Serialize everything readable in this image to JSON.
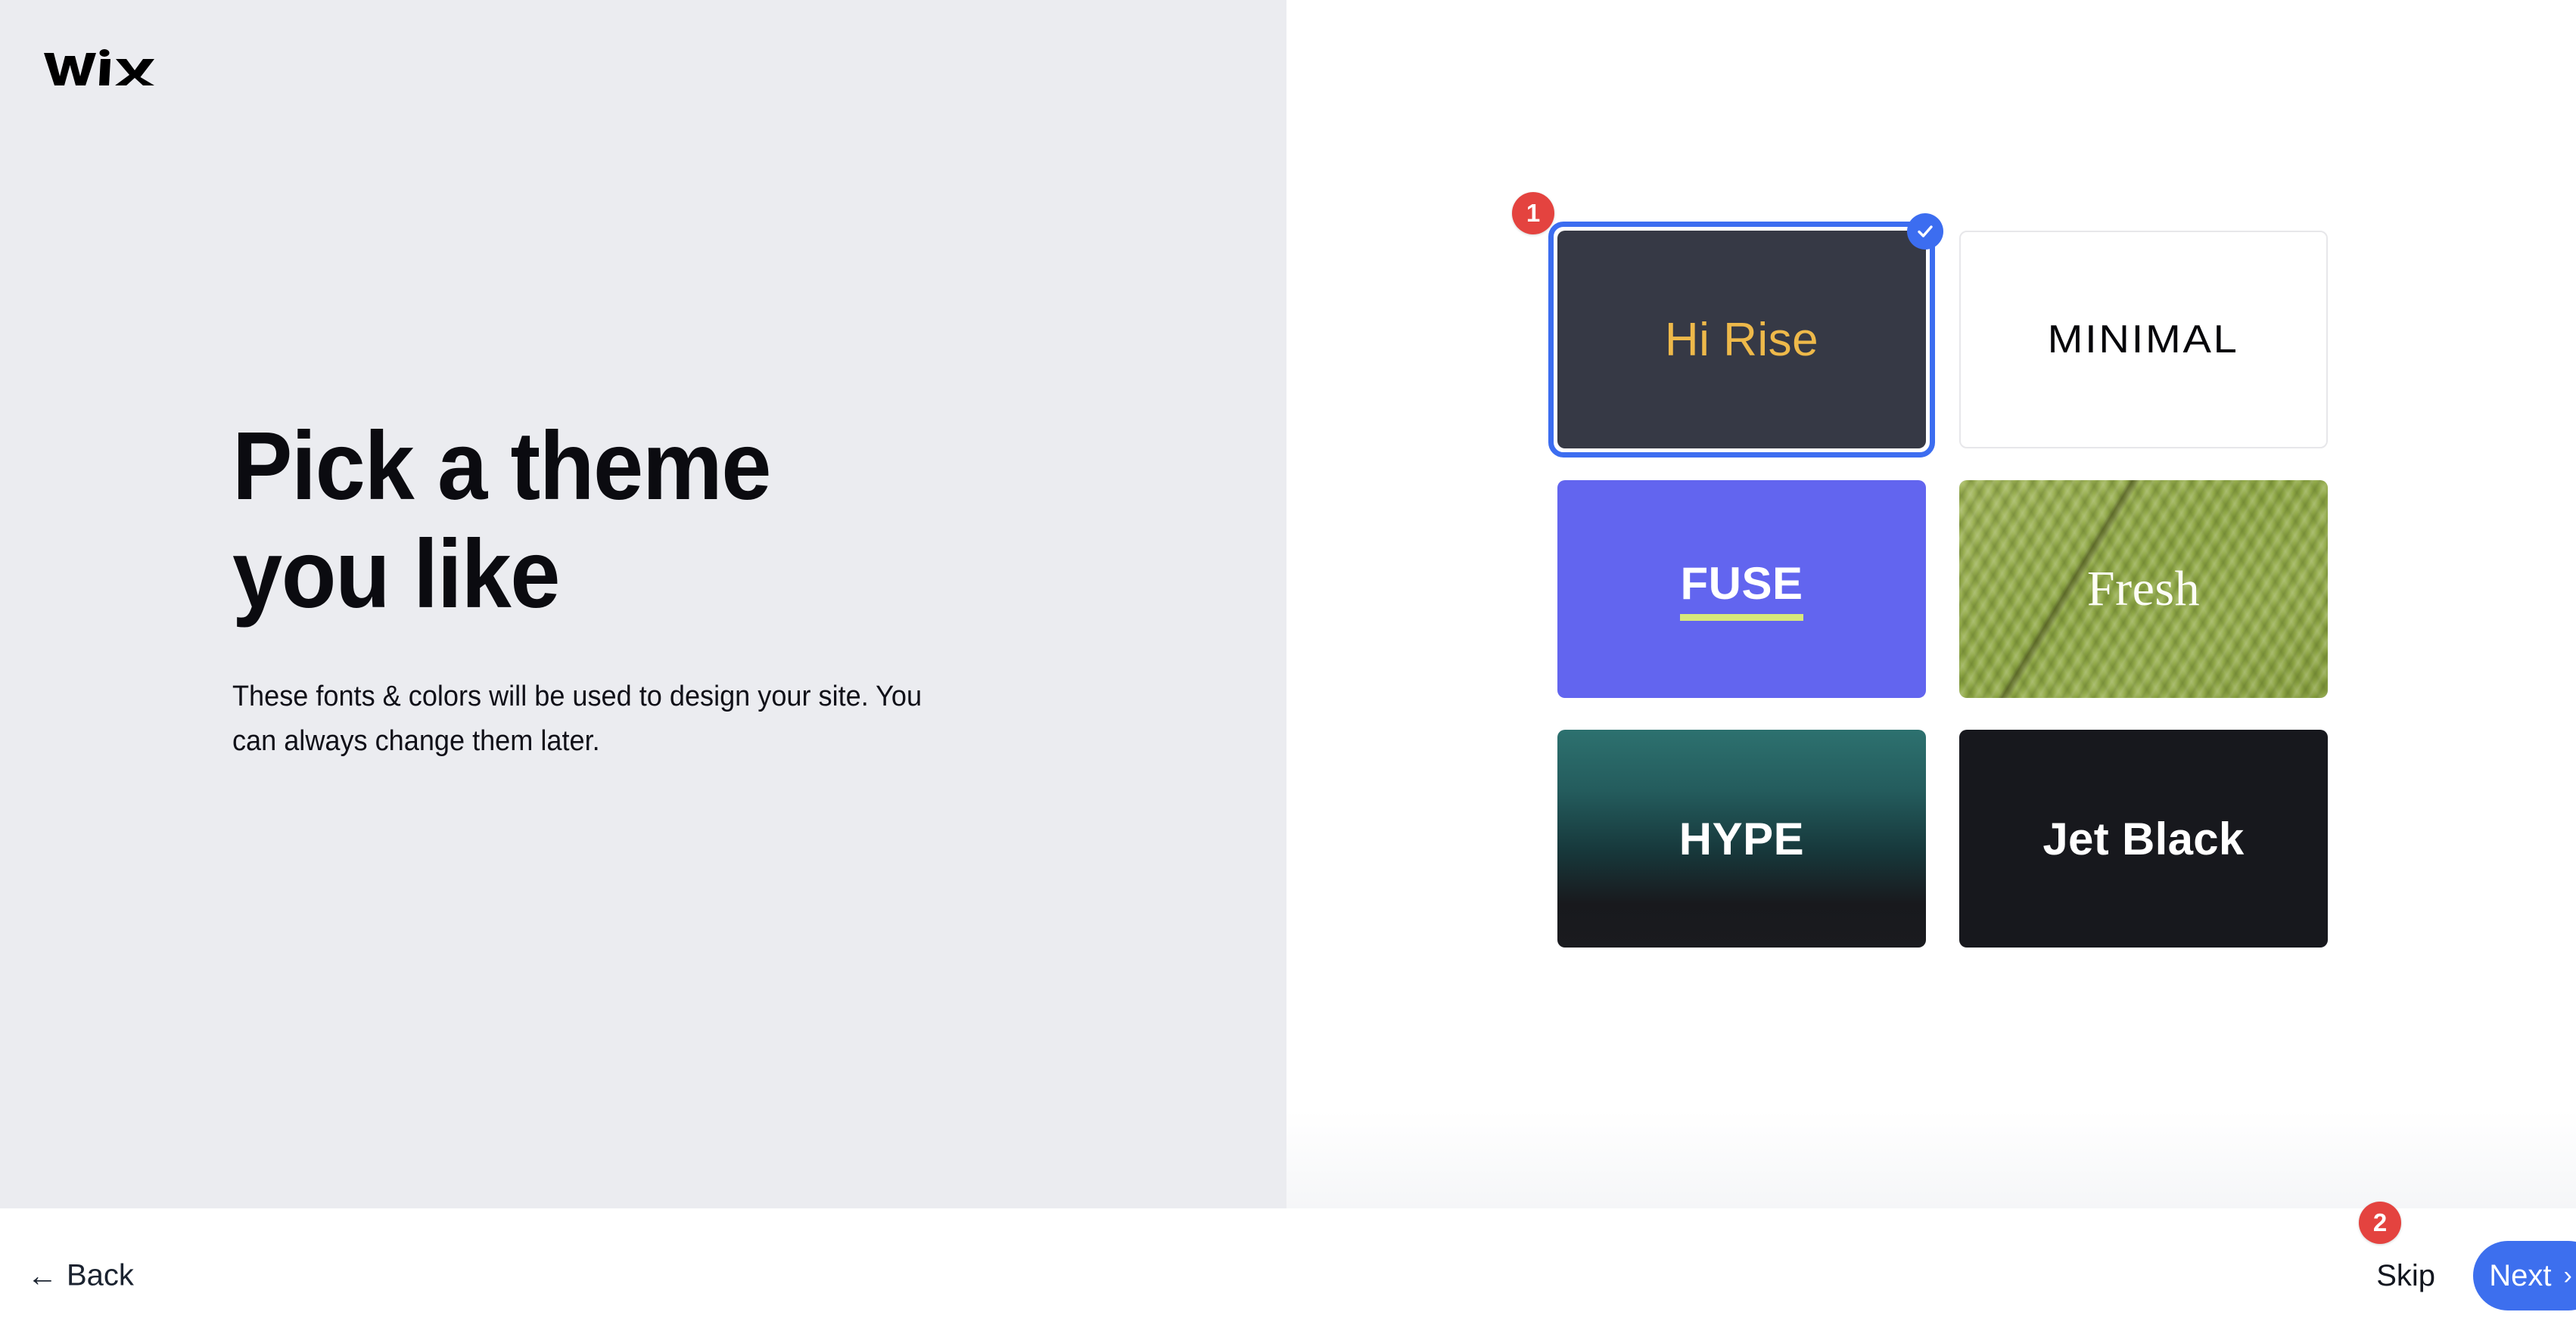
{
  "brand": {
    "logo_name": "wix-logo",
    "logo_text": "WiX"
  },
  "hero": {
    "title": "Pick a theme\nyou like",
    "subtitle": "These fonts & colors will be used to design your site. You can always change them later."
  },
  "themes": {
    "heading_hidden": "",
    "cards": [
      {
        "id": "hi-rise",
        "label": "Hi Rise",
        "selected": true,
        "bg": "#363945",
        "text_color": "#eeb94a"
      },
      {
        "id": "minimal",
        "label": "MINIMAL",
        "selected": false,
        "bg": "#ffffff",
        "text_color": "#06060a"
      },
      {
        "id": "fuse",
        "label": "FUSE",
        "selected": false,
        "bg": "#6265ef",
        "text_color": "#ffffff",
        "accent": "#d7e87b"
      },
      {
        "id": "fresh",
        "label": "Fresh",
        "selected": false,
        "bg": "#8fa845",
        "text_color": "#fdfdf6"
      },
      {
        "id": "hype",
        "label": "HYPE",
        "selected": false,
        "bg": "#2d716f",
        "text_color": "#ffffff"
      },
      {
        "id": "jet-black",
        "label": "Jet Black",
        "selected": false,
        "bg": "#17181d",
        "text_color": "#ffffff"
      }
    ],
    "selected_check_icon": "check-icon"
  },
  "annotations": [
    {
      "number": "1",
      "target": "hi-rise-theme-card"
    },
    {
      "number": "2",
      "target": "next-button"
    }
  ],
  "footer": {
    "back_label": "Back",
    "back_arrow": "←",
    "skip_label": "Skip",
    "next_label": "Next",
    "next_chevron": "›"
  },
  "colors": {
    "left_panel_bg": "#ebecf0",
    "right_panel_bg": "#ffffff",
    "accent_blue": "#3d6fee",
    "selection_ring": "#3c6df0",
    "annotation_red": "#e4433f",
    "text_dark": "#0b0b10"
  }
}
